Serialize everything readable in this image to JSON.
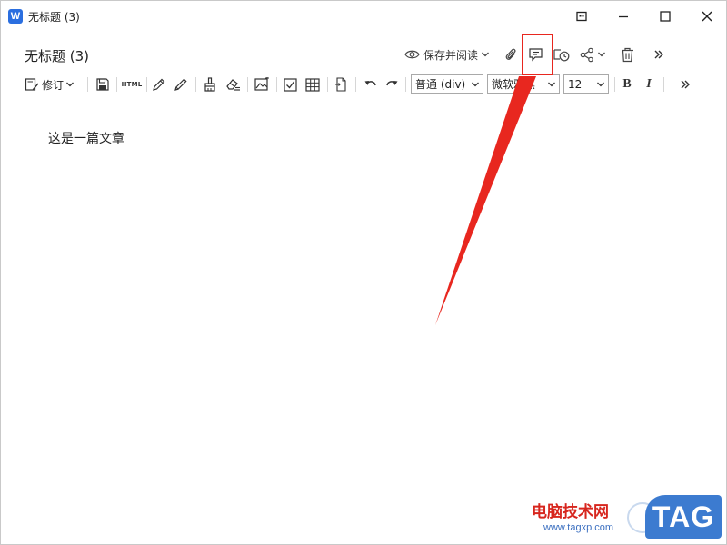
{
  "window": {
    "title": "无标题 (3)",
    "app_logo": "W"
  },
  "doc_header": {
    "title": "无标题 (3)",
    "save_and_read_label": "保存并阅读"
  },
  "toolbar": {
    "revise_label": "修订",
    "html_label": "HTML",
    "paragraph_style": "普通 (div)",
    "font_family": "微软雅黑",
    "font_size": "12",
    "bold_label": "B",
    "italic_label": "I"
  },
  "content": {
    "text": "这是一篇文章"
  },
  "watermark": {
    "site_name": "电脑技术网",
    "url": "www.tagxp.com",
    "badge": "TAG"
  },
  "colors": {
    "annotation_red": "#e8271f",
    "app_blue": "#2b6fe0",
    "watermark_blue": "#3c7bd0"
  }
}
